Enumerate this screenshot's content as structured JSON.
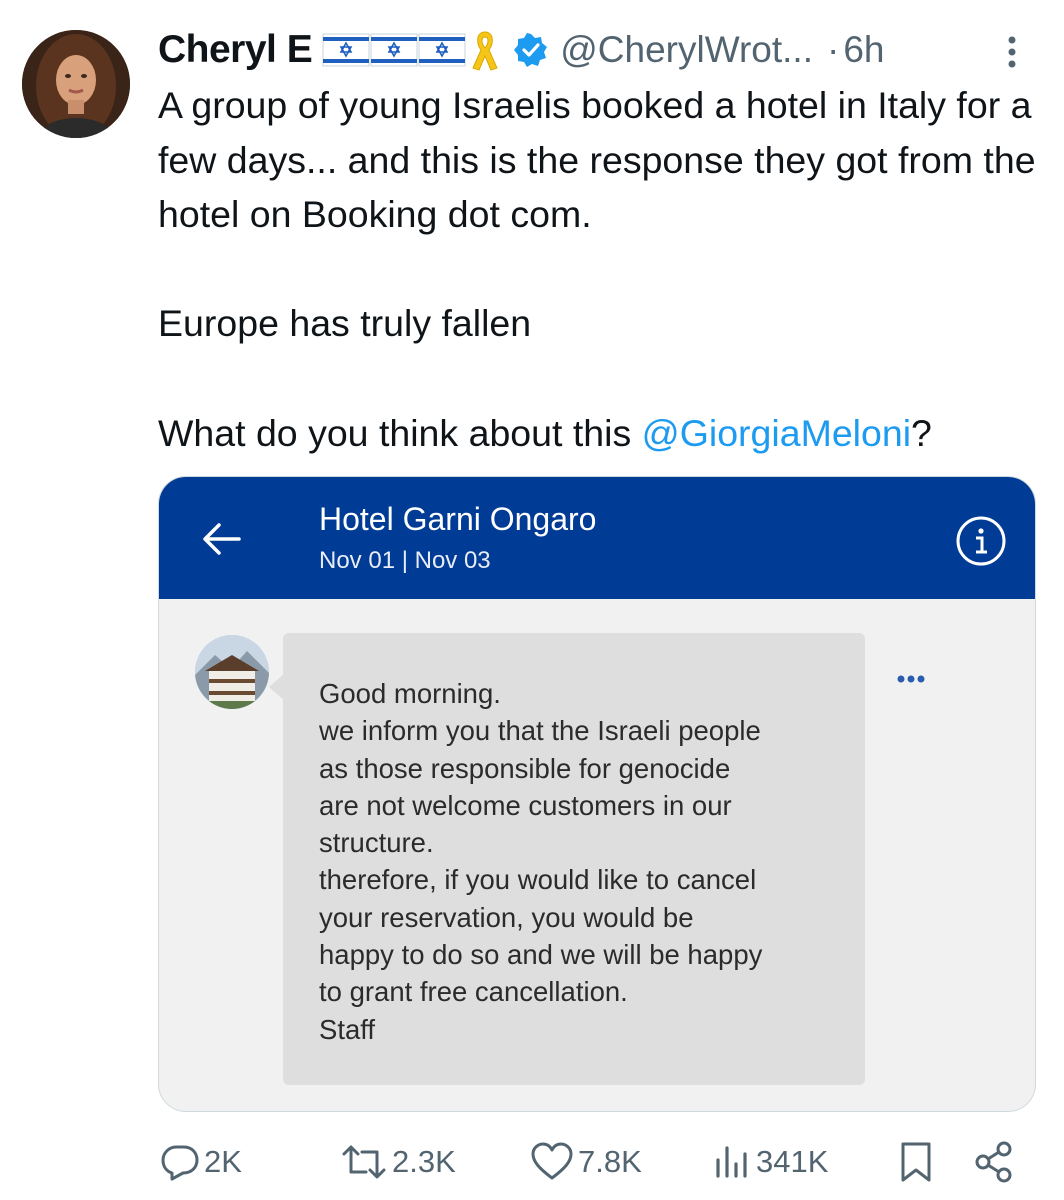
{
  "author": {
    "name": "Cheryl E",
    "flags": [
      "israel-flag-icon",
      "israel-flag-icon",
      "israel-flag-icon"
    ],
    "handle": "@CherylWrot...",
    "separator": "·",
    "time": "6h",
    "verified": true
  },
  "tweet": {
    "line1": "A group of young Israelis booked a hotel in Italy for a few days... and this is the response they got from the hotel on Booking dot com.",
    "line2": "Europe has truly fallen",
    "line3_prefix": "What do you think about this ",
    "mention": "@GiorgiaMeloni",
    "line3_suffix": "?"
  },
  "screenshot": {
    "hotel_name": "Hotel Garni Ongaro",
    "dates": "Nov 01 | Nov 03",
    "message": "Good morning.\nwe inform you that the Israeli people\nas those responsible for genocide\nare not welcome customers in our\nstructure.\ntherefore, if you would like to cancel\nyour reservation, you would be\nhappy to do so and we will be happy\nto grant free cancellation.\nStaff",
    "header_color": "#003b95"
  },
  "actions": {
    "replies": "2K",
    "reposts": "2.3K",
    "likes": "7.8K",
    "views": "341K"
  },
  "colors": {
    "accent": "#1d9bf0",
    "secondary_text": "#536471",
    "ribbon": "#f5c518"
  }
}
